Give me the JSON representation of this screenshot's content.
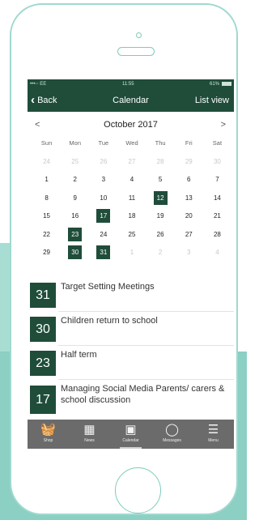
{
  "status": {
    "carrier": "•••◦◦ EE",
    "time": "11:55",
    "battery": "61%"
  },
  "nav": {
    "back": "Back",
    "title": "Calendar",
    "list_view": "List view"
  },
  "calendar": {
    "month": "October 2017",
    "prev": "<",
    "next": ">",
    "weekdays": [
      "Sun",
      "Mon",
      "Tue",
      "Wed",
      "Thu",
      "Fri",
      "Sat"
    ],
    "weeks": [
      [
        {
          "d": "24",
          "dim": true
        },
        {
          "d": "25",
          "dim": true
        },
        {
          "d": "26",
          "dim": true
        },
        {
          "d": "27",
          "dim": true
        },
        {
          "d": "28",
          "dim": true
        },
        {
          "d": "29",
          "dim": true
        },
        {
          "d": "30",
          "dim": true
        }
      ],
      [
        {
          "d": "1"
        },
        {
          "d": "2"
        },
        {
          "d": "3"
        },
        {
          "d": "4"
        },
        {
          "d": "5"
        },
        {
          "d": "6"
        },
        {
          "d": "7"
        }
      ],
      [
        {
          "d": "8"
        },
        {
          "d": "9"
        },
        {
          "d": "10"
        },
        {
          "d": "11"
        },
        {
          "d": "12",
          "event": true
        },
        {
          "d": "13"
        },
        {
          "d": "14"
        }
      ],
      [
        {
          "d": "15"
        },
        {
          "d": "16"
        },
        {
          "d": "17",
          "event": true
        },
        {
          "d": "18"
        },
        {
          "d": "19"
        },
        {
          "d": "20"
        },
        {
          "d": "21"
        }
      ],
      [
        {
          "d": "22"
        },
        {
          "d": "23",
          "event": true
        },
        {
          "d": "24"
        },
        {
          "d": "25"
        },
        {
          "d": "26"
        },
        {
          "d": "27"
        },
        {
          "d": "28"
        }
      ],
      [
        {
          "d": "29"
        },
        {
          "d": "30",
          "event": true
        },
        {
          "d": "31",
          "event": true
        },
        {
          "d": "1",
          "dim": true
        },
        {
          "d": "2",
          "dim": true
        },
        {
          "d": "3",
          "dim": true
        },
        {
          "d": "4",
          "dim": true
        }
      ]
    ]
  },
  "events": [
    {
      "day": "31",
      "title": "Target Setting Meetings"
    },
    {
      "day": "30",
      "title": "Children return to school"
    },
    {
      "day": "23",
      "title": "Half term"
    },
    {
      "day": "17",
      "title": "Managing Social Media Parents/ carers & school discussion"
    }
  ],
  "tabs": [
    {
      "label": "Shop",
      "icon": "basket-icon",
      "glyph": "🧺",
      "active": false
    },
    {
      "label": "News",
      "icon": "news-icon",
      "glyph": "▦",
      "active": false
    },
    {
      "label": "Calendar",
      "icon": "calendar-icon",
      "glyph": "▣",
      "active": true
    },
    {
      "label": "Messages",
      "icon": "chat-bubble-icon",
      "glyph": "◯",
      "active": false
    },
    {
      "label": "Menu",
      "icon": "hamburger-menu-icon",
      "glyph": "☰",
      "active": false
    }
  ],
  "colors": {
    "brand": "#1f4d3a",
    "tabbar": "#6b6b6b",
    "frame": "#9fd9cf",
    "backdrop": "#8ccfc3"
  }
}
